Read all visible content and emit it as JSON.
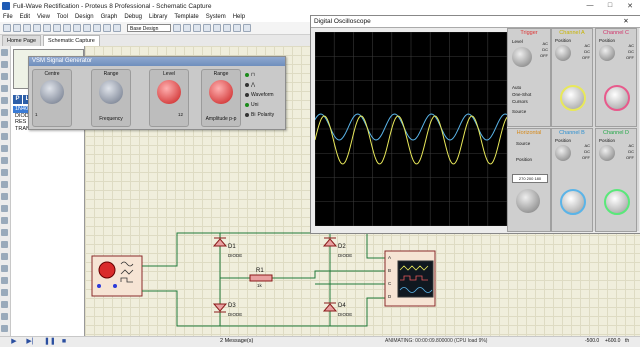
{
  "window": {
    "title": "Full-Wave Rectification - Proteus 8 Professional - Schematic Capture",
    "controls": [
      "—",
      "□",
      "✕"
    ]
  },
  "menu": [
    "File",
    "Edit",
    "View",
    "Tool",
    "Design",
    "Graph",
    "Debug",
    "Library",
    "Template",
    "System",
    "Help"
  ],
  "toolbar": {
    "design_select": "Base Design"
  },
  "tabs": [
    {
      "label": "Home Page",
      "active": false
    },
    {
      "label": "Schematic Capture",
      "active": true
    }
  ],
  "device_panel": {
    "header_buttons": [
      "P",
      "L"
    ],
    "devices": [
      "1N4001",
      "DIODE",
      "RES",
      "TRAN-2P3S"
    ],
    "selected_index": 0
  },
  "signal_generator": {
    "title": "VSM Signal Generator",
    "knobs": [
      {
        "label": "Centre",
        "scale": "1"
      },
      {
        "label": "Frequency",
        "scale": ""
      },
      {
        "label": "Level",
        "scale": "12"
      },
      {
        "label": "Amplitude p-p",
        "scale": "1"
      }
    ],
    "range_label": "Range",
    "waveform_label": "Waveform",
    "polarity_label": "Polarity",
    "polarity_options": [
      "Uni",
      "Bi"
    ]
  },
  "oscilloscope": {
    "title": "Digital Oscilloscope",
    "trigger": {
      "title": "Trigger",
      "level_label": "Level",
      "modes": [
        "Auto",
        "One-Shot",
        "Cursors"
      ],
      "source_label": "Source",
      "coupling": [
        "AC",
        "DC",
        "OFF"
      ]
    },
    "horizontal": {
      "title": "Horizontal",
      "source_label": "Source",
      "position_label": "Position",
      "readout": "270 200 180"
    },
    "channels": [
      {
        "name": "Channel A",
        "color": "#e8e85a",
        "position_label": "Position",
        "coupling": [
          "AC",
          "DC",
          "OFF"
        ]
      },
      {
        "name": "Channel B",
        "color": "#5ab4e8",
        "position_label": "Position",
        "coupling": [
          "AC",
          "DC",
          "OFF"
        ]
      },
      {
        "name": "Channel C",
        "color": "#e85a8c",
        "position_label": "Position",
        "coupling": [
          "AC",
          "DC",
          "OFF"
        ]
      },
      {
        "name": "Channel D",
        "color": "#5ae87a",
        "position_label": "Position",
        "coupling": [
          "AC",
          "DC",
          "OFF"
        ]
      }
    ]
  },
  "schematic": {
    "components": [
      {
        "ref": "D1",
        "value": "DIODE"
      },
      {
        "ref": "D2",
        "value": "DIODE"
      },
      {
        "ref": "D3",
        "value": "DIODE"
      },
      {
        "ref": "D4",
        "value": "DIODE"
      },
      {
        "ref": "R1",
        "value": "1k"
      }
    ],
    "scope_pins": [
      "A",
      "B",
      "C",
      "D"
    ]
  },
  "statusbar": {
    "messages": "2 Message(s)",
    "animating": "ANIMATING: 00:00:09.800000 (CPU load 9%)",
    "coord1": "-500.0",
    "coord2": "+600.0",
    "coord3": "th"
  }
}
